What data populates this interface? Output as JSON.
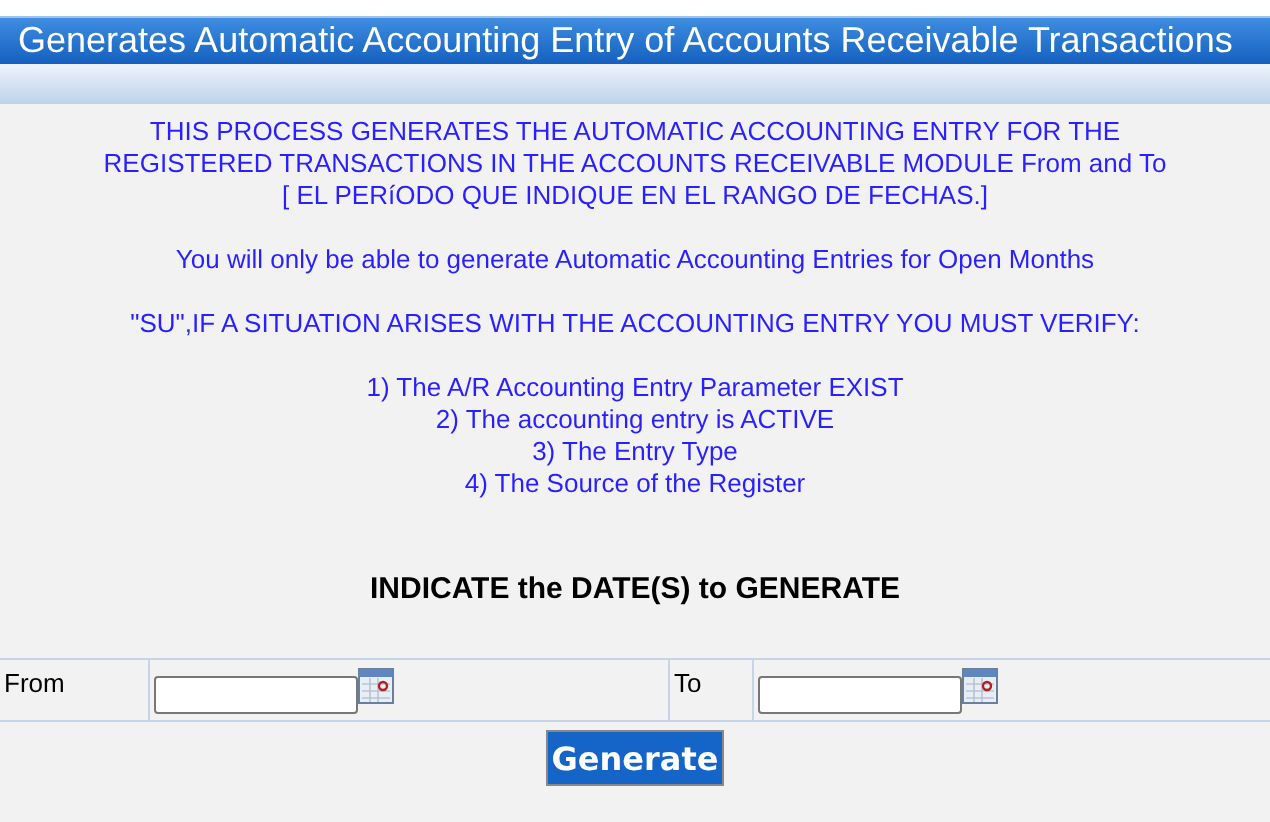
{
  "window": {
    "title": "Generates Automatic Accounting Entry of Accounts Receivable Transactions"
  },
  "notes": [
    {
      "text": "THIS PROCESS GENERATES THE AUTOMATIC ACCOUNTING ENTRY FOR THE\nREGISTERED TRANSACTIONS IN THE ACCOUNTS RECEIVABLE MODULE From and To\n[ EL PERíODO QUE INDIQUE EN EL RANGO DE FECHAS.]"
    },
    {
      "text": "You will only be able to generate Automatic Accounting Entries for Open Months"
    },
    {
      "text": "\"SU\",IF A SITUATION ARISES WITH THE ACCOUNTING ENTRY YOU MUST VERIFY:"
    }
  ],
  "checks": [
    "1) The A/R Accounting Entry Parameter EXIST",
    "2) The accounting entry is ACTIVE",
    "3) The Entry Type",
    "4) The Source of the Register"
  ],
  "heading": "INDICATE the DATE(S) to GENERATE",
  "fields": [
    {
      "label": "From"
    },
    {
      "label": "To"
    }
  ],
  "button": "Generate"
}
